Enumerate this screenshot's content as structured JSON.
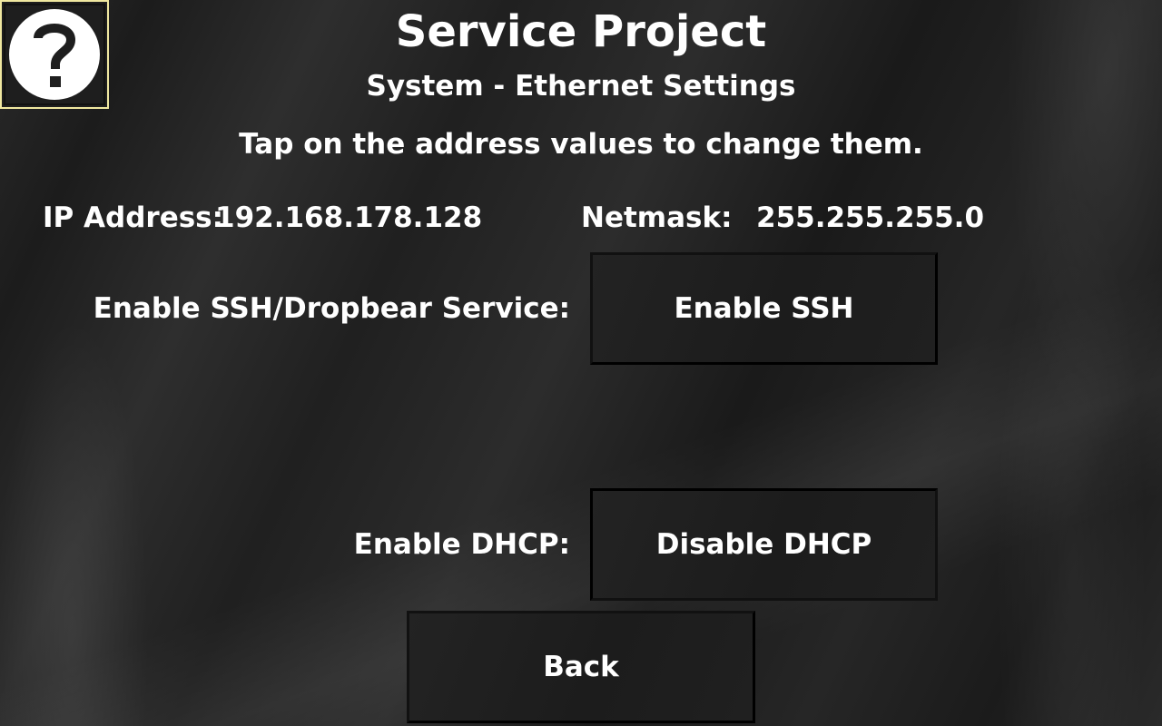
{
  "header": {
    "title": "Service Project",
    "subtitle": "System - Ethernet Settings"
  },
  "help_button": {
    "icon": "question-mark-icon",
    "glyph": "?",
    "border_color": "#f0e8a0"
  },
  "instruction": "Tap on the address values to change them.",
  "network": {
    "ip_label": "IP Address:",
    "ip_value": "192.168.178.128",
    "netmask_label": "Netmask:",
    "netmask_value": "255.255.255.0"
  },
  "ssh": {
    "label": "Enable SSH/Dropbear Service:",
    "button_label": "Enable SSH"
  },
  "dhcp": {
    "label": "Enable DHCP:",
    "button_label": "Disable DHCP"
  },
  "footer": {
    "back_label": "Back"
  }
}
